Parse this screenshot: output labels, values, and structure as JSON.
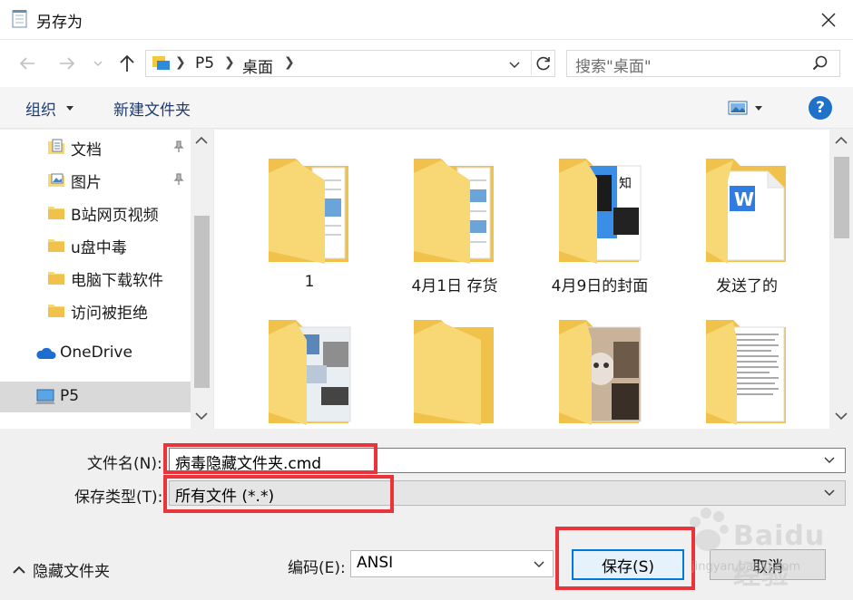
{
  "window": {
    "title": "另存为",
    "close_icon": "close-icon"
  },
  "address": {
    "crumbs": [
      "P5",
      "桌面"
    ],
    "search_placeholder": "搜索\"桌面\""
  },
  "toolbar": {
    "organize_label": "组织",
    "new_folder_label": "新建文件夹",
    "help_label": "?"
  },
  "nav": {
    "items": [
      {
        "label": "文档",
        "icon": "documents-folder-icon",
        "pinned": true
      },
      {
        "label": "图片",
        "icon": "pictures-folder-icon",
        "pinned": true
      },
      {
        "label": "B站网页视频",
        "icon": "folder-icon",
        "pinned": false
      },
      {
        "label": "u盘中毒",
        "icon": "folder-icon",
        "pinned": false
      },
      {
        "label": "电脑下载软件",
        "icon": "folder-icon",
        "pinned": false
      },
      {
        "label": "访问被拒绝",
        "icon": "folder-icon",
        "pinned": false
      }
    ],
    "onedrive_label": "OneDrive",
    "pc_label": "P5"
  },
  "files": [
    {
      "label": "1",
      "kind": "folder-docs"
    },
    {
      "label": "4月1日 存货",
      "kind": "folder-docs"
    },
    {
      "label": "4月9日的封面",
      "kind": "folder-images"
    },
    {
      "label": "发送了的",
      "kind": "folder-word"
    },
    {
      "label": "",
      "kind": "folder-photos"
    },
    {
      "label": "",
      "kind": "folder-empty"
    },
    {
      "label": "",
      "kind": "folder-cat"
    },
    {
      "label": "",
      "kind": "folder-text"
    }
  ],
  "form": {
    "filename_label": "文件名(N):",
    "filename_value": "病毒隐藏文件夹.cmd",
    "type_label": "保存类型(T):",
    "type_value": "所有文件  (*.*)",
    "hide_folders_label": "隐藏文件夹",
    "encoding_label": "编码(E):",
    "encoding_value": "ANSI",
    "save_label": "保存(S)",
    "cancel_label": "取消"
  },
  "watermark": {
    "text": "Baidu经验",
    "url": "jingyan.baidu.com"
  },
  "colors": {
    "accent": "#0078d7",
    "highlight": "#e8343a",
    "folder": "#f8d775"
  }
}
